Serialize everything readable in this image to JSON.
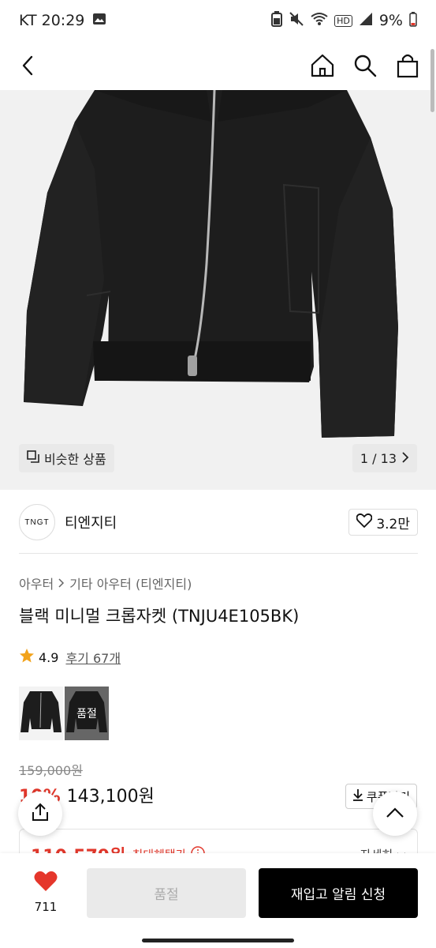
{
  "status_bar": {
    "carrier_time": "KT 20:29",
    "network_badge": "HD",
    "battery": "9%"
  },
  "app_bar": {
    "back": "back-icon",
    "home": "home-icon",
    "search": "search-icon",
    "cart": "bag-icon"
  },
  "gallery": {
    "similar_label": "비슷한 상품",
    "pager": "1 / 13"
  },
  "brand": {
    "logo_text": "TNGT",
    "name": "티엔지티",
    "likes": "3.2만"
  },
  "breadcrumb": [
    "아우터",
    "기타 아우터 (티엔지티)"
  ],
  "product": {
    "title": "블랙 미니멀 크롭자켓 (TNJU4E105BK)",
    "rating": "4.9",
    "reviews": "후기 67개"
  },
  "thumbnails": [
    {
      "state": "normal"
    },
    {
      "state": "soldout",
      "label": "품절"
    }
  ],
  "pricing": {
    "original": "159,000원",
    "discount": "10%",
    "price": "143,100원",
    "coupon_label": "쿠폰받기"
  },
  "benefit": {
    "price": "110,579원",
    "label": "최대혜택가",
    "detail": "자세히"
  },
  "bottom_bar": {
    "wish_count": "711",
    "soldout_label": "품절",
    "restock_label": "재입고 알림 신청"
  },
  "colors": {
    "accent_red": "#e2372b",
    "star": "#f2a31b",
    "heart": "#e5362b"
  }
}
